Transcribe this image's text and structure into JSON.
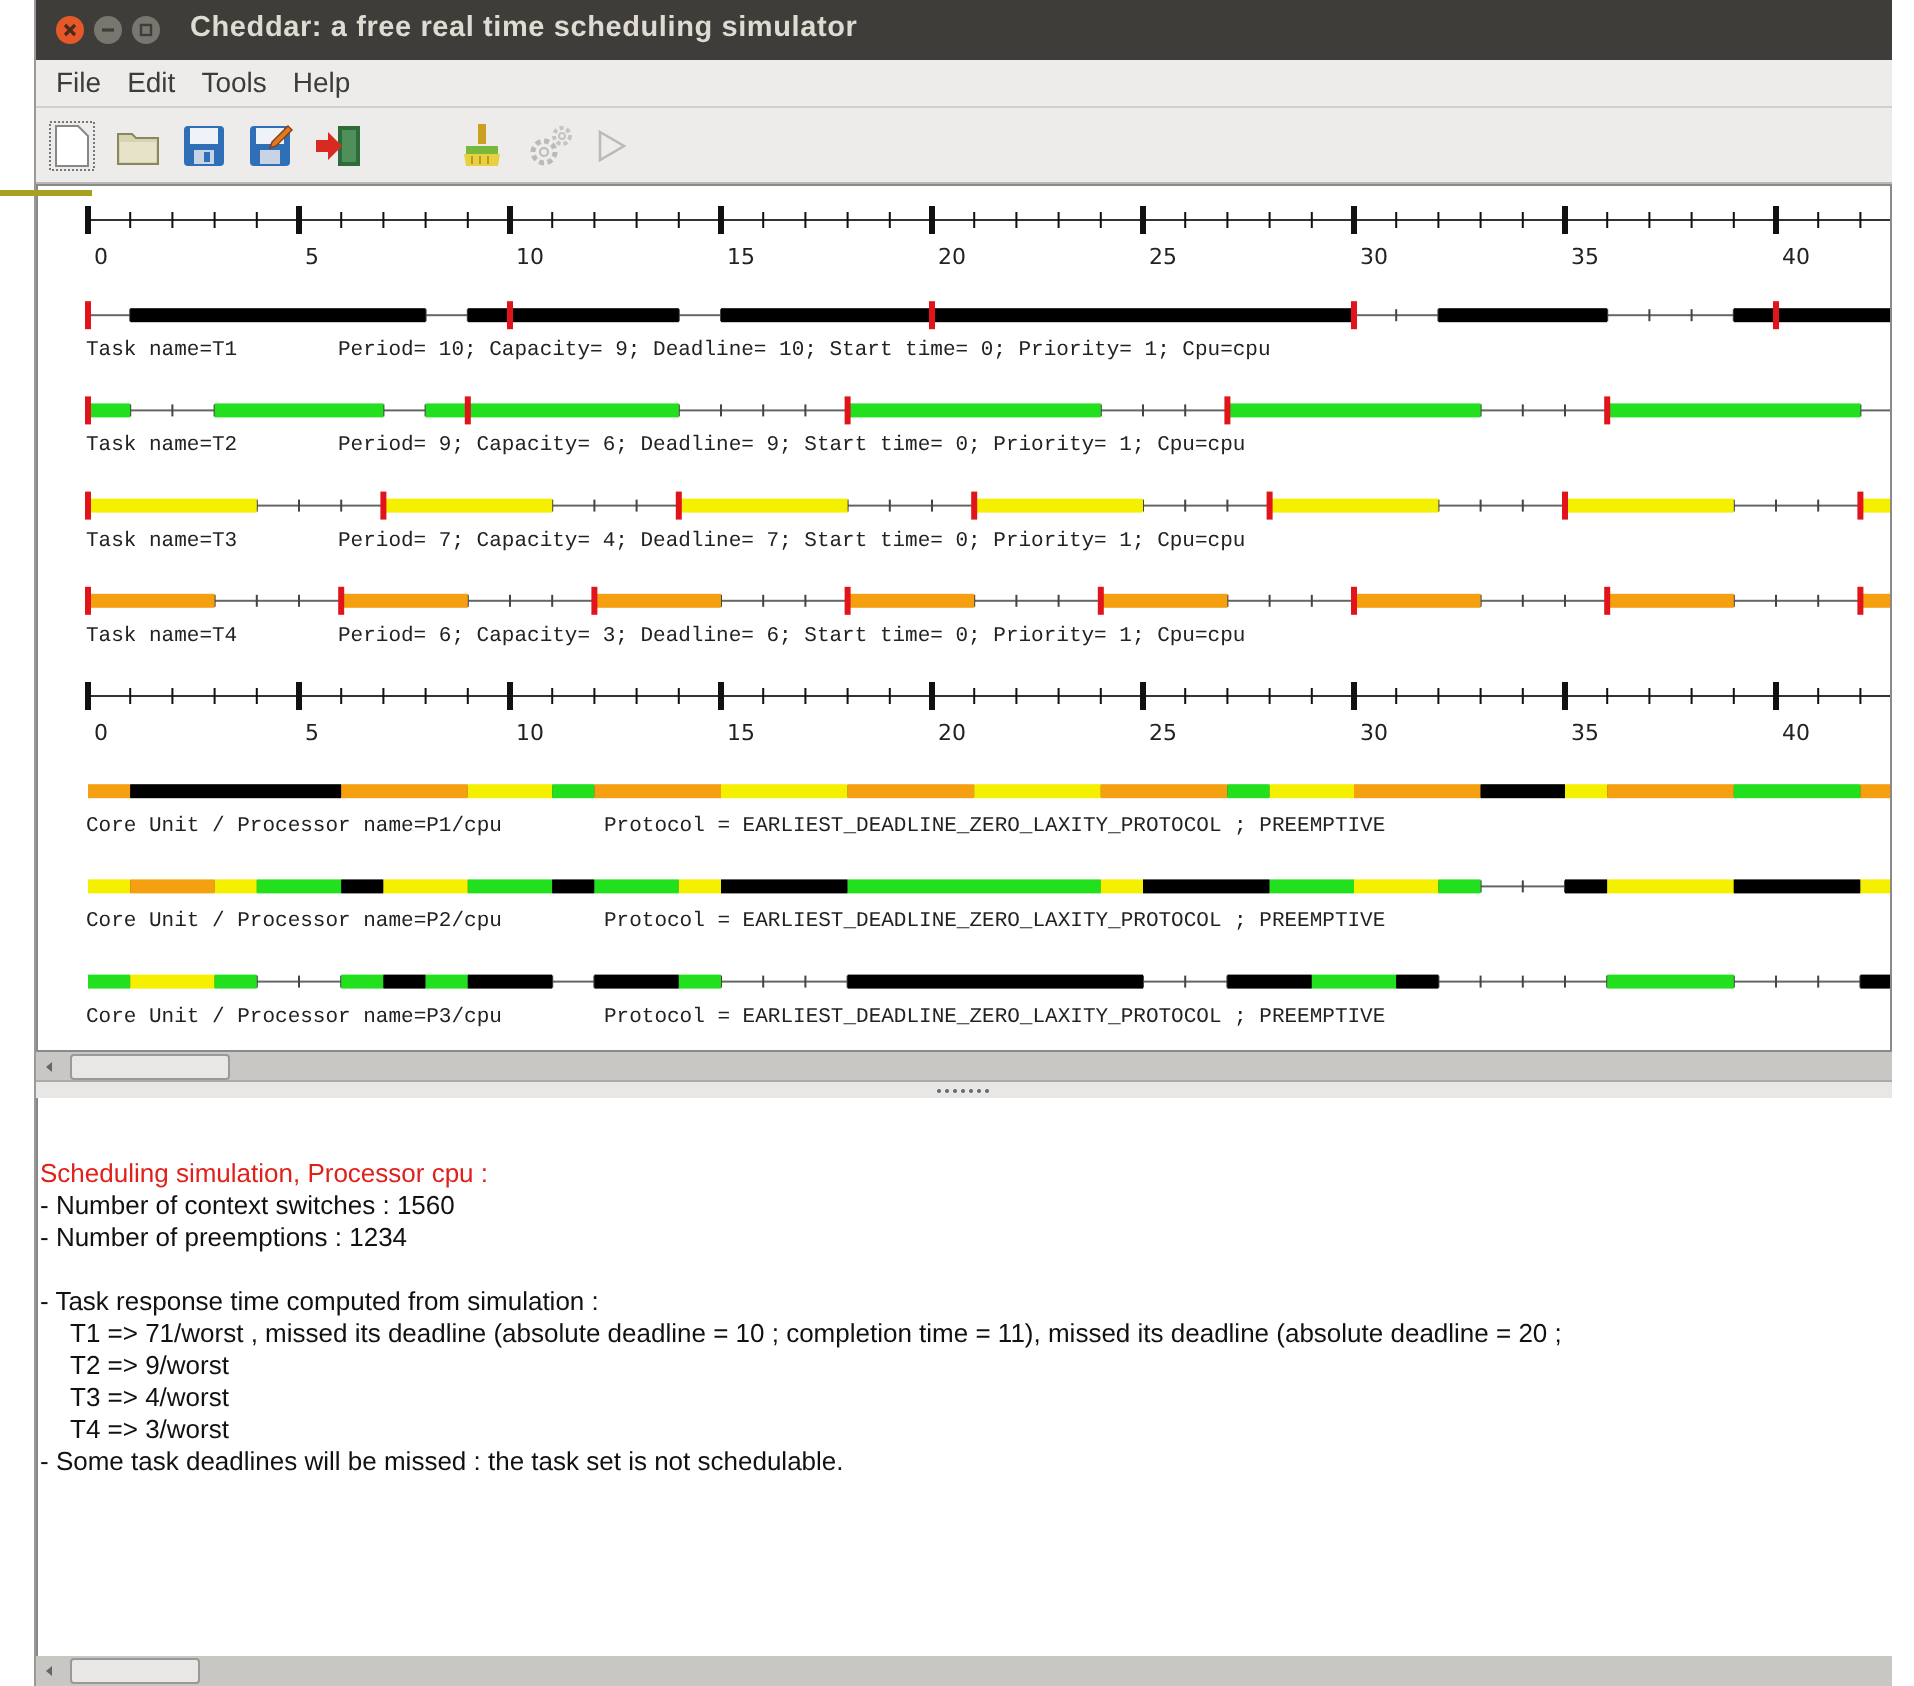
{
  "window": {
    "title": "Cheddar: a free real time scheduling simulator"
  },
  "menu": [
    "File",
    "Edit",
    "Tools",
    "Help"
  ],
  "toolbar": [
    {
      "kind": "new",
      "disabled": false
    },
    {
      "kind": "open",
      "disabled": false
    },
    {
      "kind": "save",
      "disabled": false
    },
    {
      "kind": "save_as",
      "disabled": false
    },
    {
      "kind": "exit",
      "disabled": false
    },
    {
      "kind": "clean",
      "disabled": false
    },
    {
      "kind": "gears",
      "disabled": true
    },
    {
      "kind": "play",
      "disabled": true
    }
  ],
  "timeline": {
    "rows": [
      {
        "kind": "axis",
        "labels": [
          "0",
          "5",
          "10",
          "15",
          "20",
          "25",
          "30",
          "35",
          "40"
        ]
      },
      {
        "kind": "task",
        "name": "Task name=T1",
        "params": "Period= 10; Capacity= 9; Deadline= 10; Start time= 0; Priority= 1; Cpu=cpu"
      },
      {
        "kind": "task",
        "name": "Task name=T2",
        "params": "Period= 9; Capacity= 6; Deadline= 9; Start time= 0; Priority= 1; Cpu=cpu"
      },
      {
        "kind": "task",
        "name": "Task name=T3",
        "params": "Period= 7; Capacity= 4; Deadline= 7; Start time= 0; Priority= 1; Cpu=cpu"
      },
      {
        "kind": "task",
        "name": "Task name=T4",
        "params": "Period= 6; Capacity= 3; Deadline= 6; Start time= 0; Priority= 1; Cpu=cpu"
      },
      {
        "kind": "axis",
        "labels": [
          "0",
          "5",
          "10",
          "15",
          "20",
          "25",
          "30",
          "35",
          "40"
        ]
      },
      {
        "kind": "processor",
        "name": "Core Unit / Processor name=P1/cpu",
        "protocol": "Protocol = EARLIEST_DEADLINE_ZERO_LAXITY_PROTOCOL ; PREEMPTIVE"
      },
      {
        "kind": "processor",
        "name": "Core Unit / Processor name=P2/cpu",
        "protocol": "Protocol = EARLIEST_DEADLINE_ZERO_LAXITY_PROTOCOL ; PREEMPTIVE"
      },
      {
        "kind": "processor",
        "name": "Core Unit / Processor name=P3/cpu",
        "protocol": "Protocol = EARLIEST_DEADLINE_ZERO_LAXITY_PROTOCOL ; PREEMPTIVE"
      }
    ]
  },
  "output": [
    {
      "kind": "heading",
      "text": "Scheduling simulation, Processor cpu :"
    },
    {
      "kind": "item",
      "text": "- Number of context switches :  1560"
    },
    {
      "kind": "item",
      "text": "- Number of preemptions :  1234"
    },
    {
      "kind": "spaced_item",
      "text": "- Task response time computed from simulation :"
    },
    {
      "kind": "subitem",
      "text": "T1 => 71/worst ,  missed its deadline (absolute deadline =  10 ; completion time =  11),  missed its deadline (absolute deadline =  20 ;"
    },
    {
      "kind": "subitem",
      "text": "T2 => 9/worst"
    },
    {
      "kind": "subitem",
      "text": "T3 => 4/worst"
    },
    {
      "kind": "subitem",
      "text": "T4 => 3/worst"
    },
    {
      "kind": "item",
      "text": "- Some task deadlines will be missed : the task set is not schedulable."
    }
  ]
}
